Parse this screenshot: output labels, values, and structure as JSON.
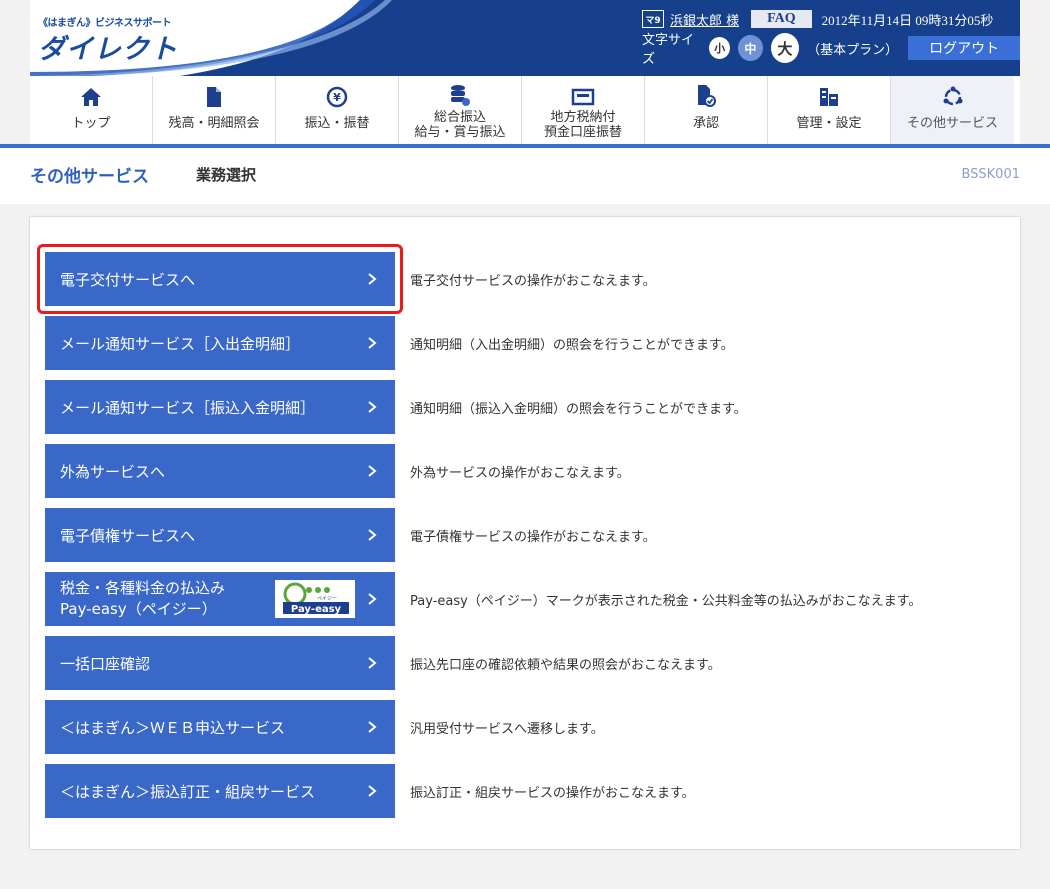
{
  "header": {
    "logo_sub": "《はまぎん》ビジネスサポート",
    "logo_main": "ダイレクト",
    "user_mark": "マ9",
    "user_name": "浜銀太郎 様",
    "faq": "FAQ",
    "datetime": "2012年11月14日 09時31分05秒",
    "font_size_label": "文字サイズ",
    "font_sizes": [
      "小",
      "中",
      "大"
    ],
    "plan": "（基本プラン）",
    "logout": "ログアウト"
  },
  "nav": {
    "items": [
      {
        "label": "トップ",
        "icon": "home-icon"
      },
      {
        "label": "残高・明細照会",
        "icon": "document-icon"
      },
      {
        "label": "振込・振替",
        "icon": "yen-transfer-icon"
      },
      {
        "label_line1": "総合振込",
        "label_line2": "給与・賞与振込",
        "icon": "database-icon"
      },
      {
        "label_line1": "地方税納付",
        "label_line2": "預金口座振替",
        "icon": "tax-card-icon"
      },
      {
        "label": "承認",
        "icon": "approve-icon"
      },
      {
        "label": "管理・設定",
        "icon": "settings-building-icon"
      },
      {
        "label": "その他サービス",
        "icon": "other-services-icon"
      }
    ]
  },
  "page": {
    "title": "その他サービス",
    "subtitle": "業務選択",
    "screen_id": "BSSK001"
  },
  "services": [
    {
      "label": "電子交付サービスへ",
      "desc": "電子交付サービスの操作がおこなえます。"
    },
    {
      "label": "メール通知サービス［入出金明細］",
      "desc": "通知明細（入出金明細）の照会を行うことができます。"
    },
    {
      "label": "メール通知サービス［振込入金明細］",
      "desc": "通知明細（振込入金明細）の照会を行うことができます。"
    },
    {
      "label": "外為サービスへ",
      "desc": "外為サービスの操作がおこなえます。"
    },
    {
      "label": "電子債権サービスへ",
      "desc": "電子債権サービスの操作がおこなえます。"
    },
    {
      "label_line1": "税金・各種料金の払込み",
      "label_line2": "Pay-easy（ペイジー）",
      "desc": "Pay-easy（ペイジー）マークが表示された税金・公共料金等の払込みがおこなえます。",
      "logo_text": "Pay-easy",
      "logo_small": "ペイジー"
    },
    {
      "label": "一括口座確認",
      "desc": "振込先口座の確認依頼や結果の照会がおこなえます。"
    },
    {
      "label": "＜はまぎん＞ＷＥＢ申込サービス",
      "desc": "汎用受付サービスへ遷移します。"
    },
    {
      "label": "＜はまぎん＞振込訂正・組戻サービス",
      "desc": "振込訂正・組戻サービスの操作がおこなえます。"
    }
  ],
  "colors": {
    "header_blue": "#163f8c",
    "button_blue": "#3a68c8",
    "highlight_red": "#e81c1c",
    "title_blue": "#2f5fbf"
  }
}
